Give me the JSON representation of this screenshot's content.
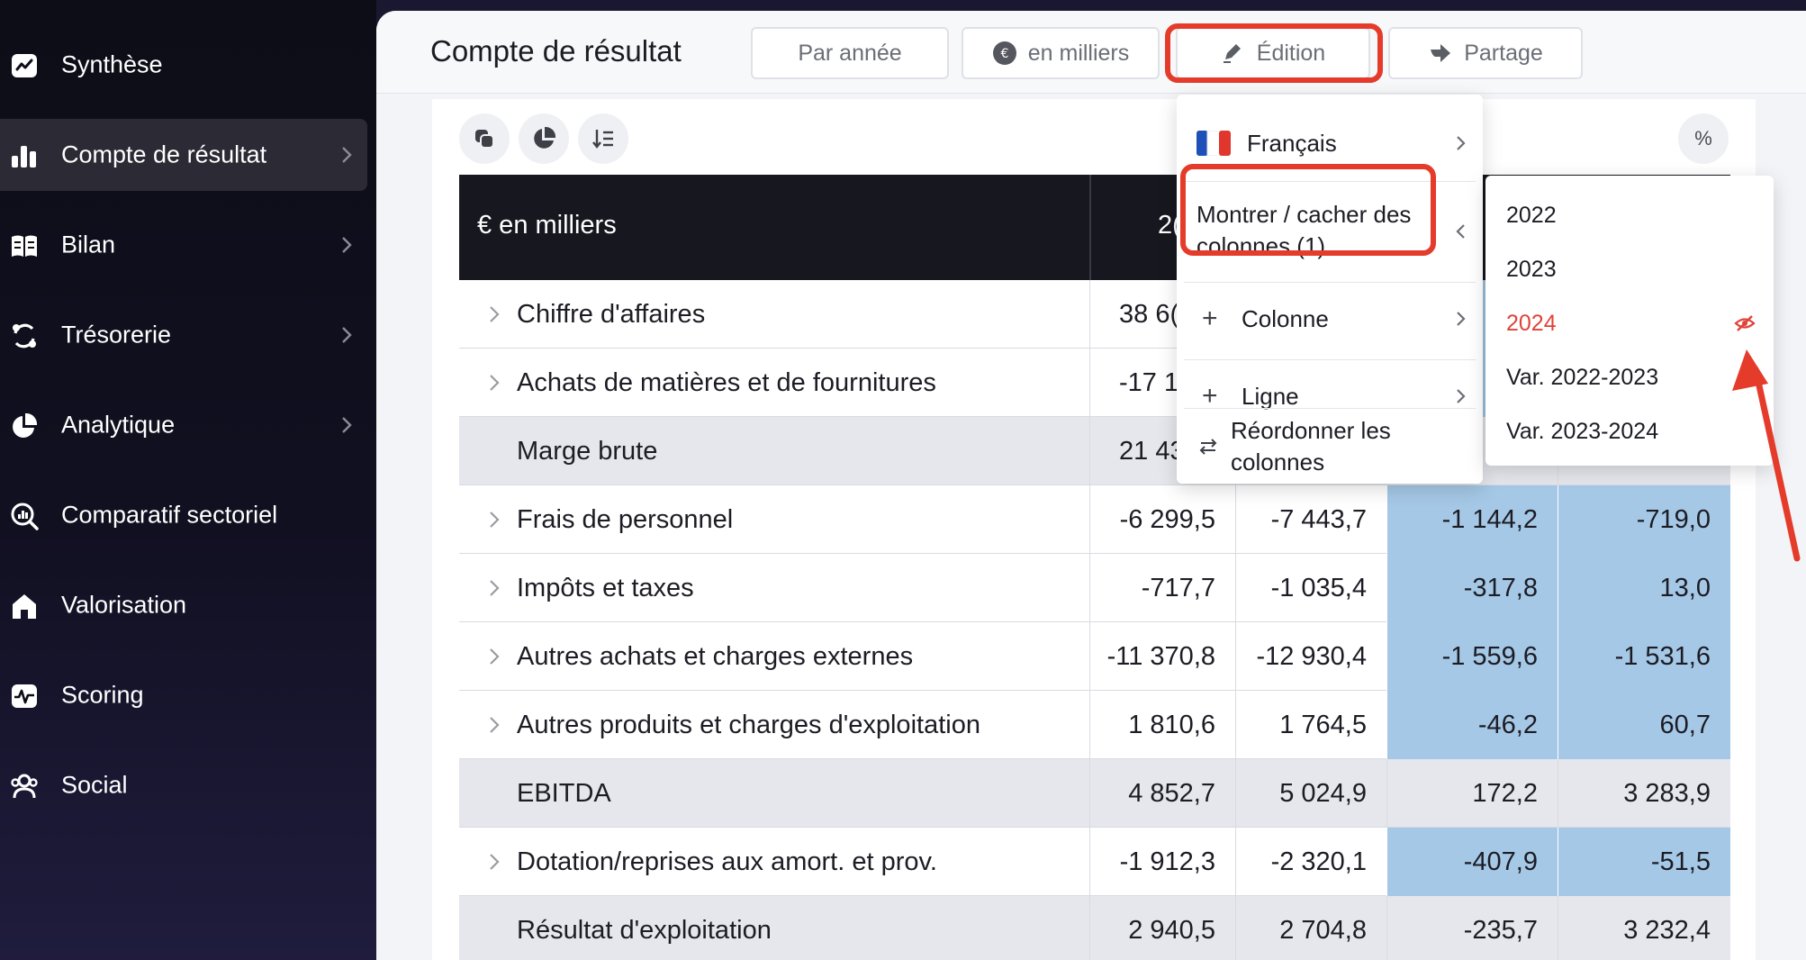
{
  "colors": {
    "accent_red": "#e53b2b",
    "hidden_item": "#e0433a",
    "highlight_blue": "#a5c8e6",
    "header_dark": "#17171f",
    "sidebar_dark": "#0d0d17"
  },
  "sidebar": {
    "items": [
      {
        "label": "Synthèse",
        "icon": "line-chart-icon",
        "has_chevron": false,
        "active": false
      },
      {
        "label": "Compte de résultat",
        "icon": "bar-chart-icon",
        "has_chevron": true,
        "active": true
      },
      {
        "label": "Bilan",
        "icon": "book-icon",
        "has_chevron": true,
        "active": false
      },
      {
        "label": "Trésorerie",
        "icon": "cycle-icon",
        "has_chevron": true,
        "active": false
      },
      {
        "label": "Analytique",
        "icon": "pie-chart-icon",
        "has_chevron": true,
        "active": false
      },
      {
        "label": "Comparatif sectoriel",
        "icon": "magnifier-chart-icon",
        "has_chevron": false,
        "active": false
      },
      {
        "label": "Valorisation",
        "icon": "home-icon",
        "has_chevron": false,
        "active": false
      },
      {
        "label": "Scoring",
        "icon": "pulse-icon",
        "has_chevron": false,
        "active": false
      },
      {
        "label": "Social",
        "icon": "users-icon",
        "has_chevron": false,
        "active": false
      }
    ]
  },
  "header": {
    "title": "Compte de résultat",
    "buttons": {
      "period": "Par année",
      "unit": "en milliers",
      "edit": "Édition",
      "share": "Partage"
    }
  },
  "toolbar": {
    "percent_label": "%"
  },
  "table": {
    "header_label": "€ en milliers",
    "col1_partial": "2(",
    "rows": [
      {
        "label": "Chiffre d'affaires",
        "expandable": true,
        "subtotal": false,
        "values": [
          "38 6(",
          "",
          "",
          ""
        ]
      },
      {
        "label": "Achats de matières et de fournitures",
        "expandable": true,
        "subtotal": false,
        "values": [
          "-17 1",
          "",
          "",
          ""
        ]
      },
      {
        "label": "Marge brute",
        "expandable": false,
        "subtotal": true,
        "values": [
          "21 43",
          "",
          "",
          ""
        ]
      },
      {
        "label": "Frais de personnel",
        "expandable": true,
        "subtotal": false,
        "values": [
          "-6 299,5",
          "-7 443,7",
          "-1 144,2",
          "-719,0"
        ]
      },
      {
        "label": "Impôts et taxes",
        "expandable": true,
        "subtotal": false,
        "values": [
          "-717,7",
          "-1 035,4",
          "-317,8",
          "13,0"
        ]
      },
      {
        "label": "Autres achats et charges externes",
        "expandable": true,
        "subtotal": false,
        "values": [
          "-11 370,8",
          "-12 930,4",
          "-1 559,6",
          "-1 531,6"
        ]
      },
      {
        "label": "Autres produits et charges d'exploitation",
        "expandable": true,
        "subtotal": false,
        "values": [
          "1 810,6",
          "1 764,5",
          "-46,2",
          "60,7"
        ]
      },
      {
        "label": "EBITDA",
        "expandable": false,
        "subtotal": true,
        "values": [
          "4 852,7",
          "5 024,9",
          "172,2",
          "3 283,9"
        ]
      },
      {
        "label": "Dotation/reprises aux amort. et prov.",
        "expandable": true,
        "subtotal": false,
        "values": [
          "-1 912,3",
          "-2 320,1",
          "-407,9",
          "-51,5"
        ]
      },
      {
        "label": "Résultat d'exploitation",
        "expandable": false,
        "subtotal": true,
        "values": [
          "2 940,5",
          "2 704,8",
          "-235,7",
          "3 232,4"
        ]
      }
    ]
  },
  "edit_menu": {
    "language": "Français",
    "show_hide_columns_line1": "Montrer / cacher des",
    "show_hide_columns_line2": "colonnes (1)",
    "add_column": "Colonne",
    "add_row": "Ligne",
    "reorder_line1": "Réordonner les",
    "reorder_line2": "colonnes"
  },
  "columns_menu": {
    "items": [
      {
        "label": "2022",
        "hidden": false
      },
      {
        "label": "2023",
        "hidden": false
      },
      {
        "label": "2024",
        "hidden": true
      },
      {
        "label": "Var. 2022-2023",
        "hidden": false
      },
      {
        "label": "Var. 2023-2024",
        "hidden": false
      }
    ]
  }
}
